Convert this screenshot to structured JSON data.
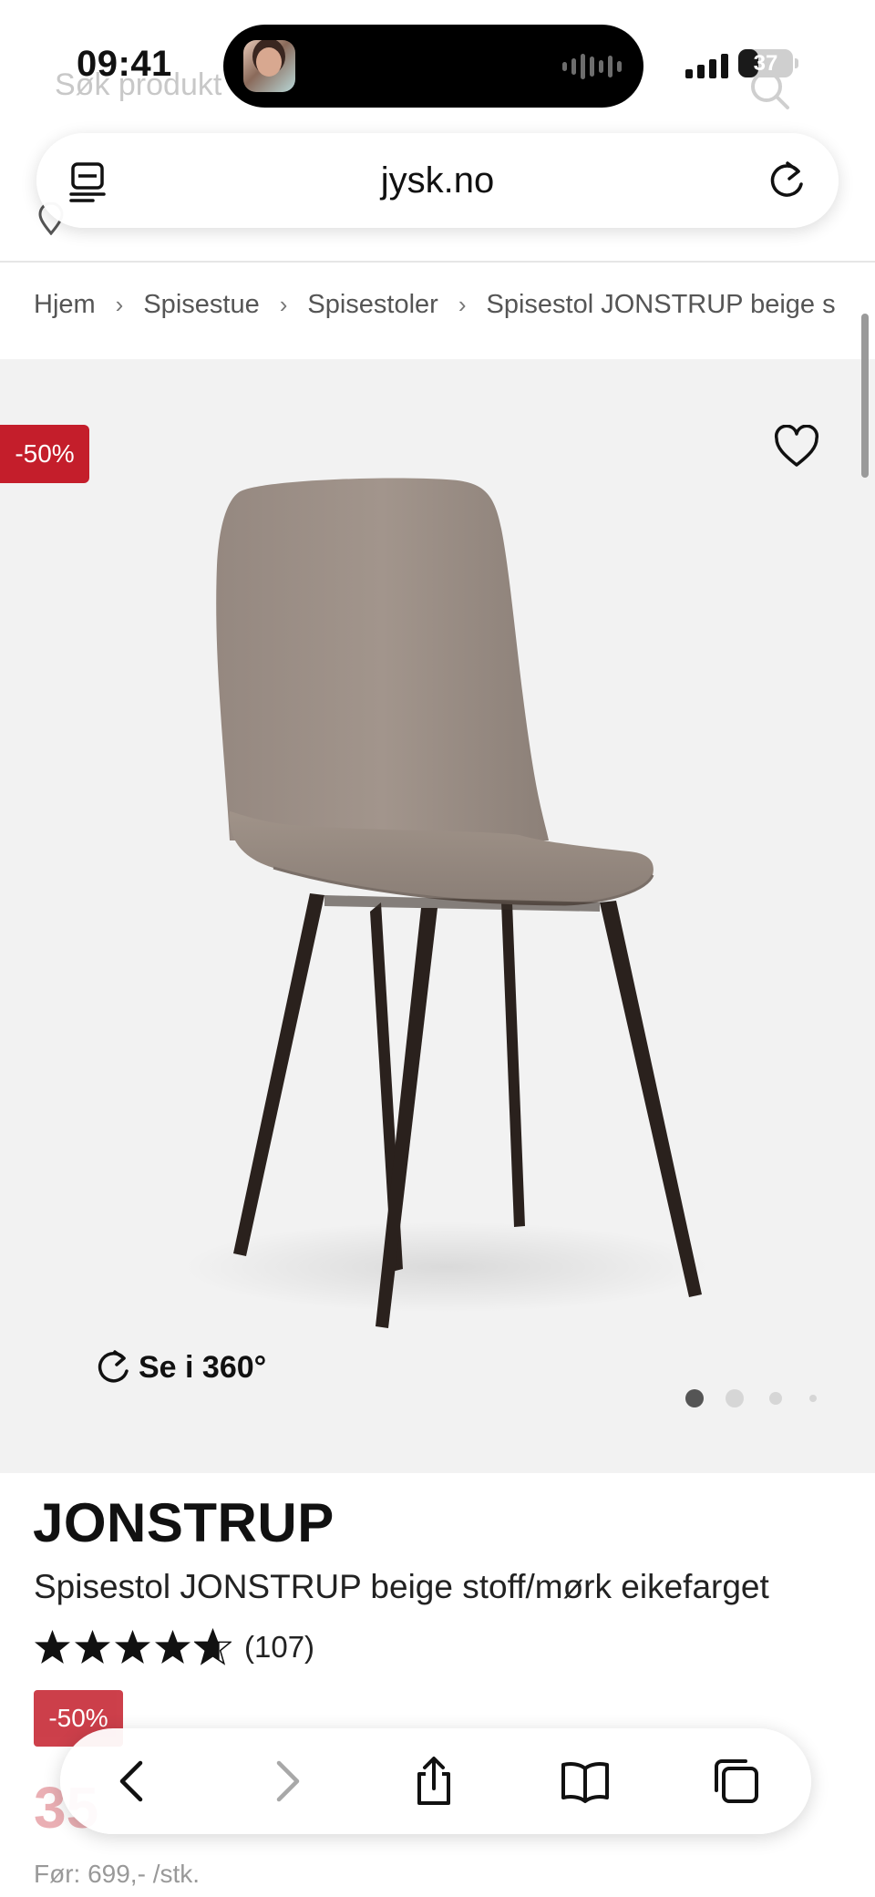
{
  "status_bar": {
    "time": "09:41",
    "battery_percent": "37",
    "battery_level": 0.37
  },
  "background_search": {
    "placeholder": "Søk produkt"
  },
  "url_bar": {
    "domain": "jysk.no",
    "left_icon": "tabs-list-icon",
    "right_icon": "reload-icon"
  },
  "breadcrumb": {
    "items": [
      "Hjem",
      "Spisestue",
      "Spisestoler",
      "Spisestol JONSTRUP beige s"
    ]
  },
  "gallery": {
    "discount_badge": "-50%",
    "rotate_label": "Se i 360°",
    "image_count": 4,
    "active_image": 1
  },
  "product": {
    "brand": "JONSTRUP",
    "name": "Spisestol JONSTRUP beige stoff/mørk eikefarget",
    "rating_stars": 4.5,
    "review_count": "(107)",
    "price_badge": "-50%",
    "price": "35",
    "before_price": "Før: 699,- /stk."
  },
  "colors": {
    "accent_red": "#c41e2b",
    "gallery_bg": "#f2f2f2",
    "chair_fabric": "#9d9087",
    "chair_legs": "#2a211d"
  },
  "toolbar": {
    "buttons": [
      "back-icon",
      "forward-icon",
      "share-icon",
      "bookmarks-icon",
      "tabs-icon"
    ]
  }
}
